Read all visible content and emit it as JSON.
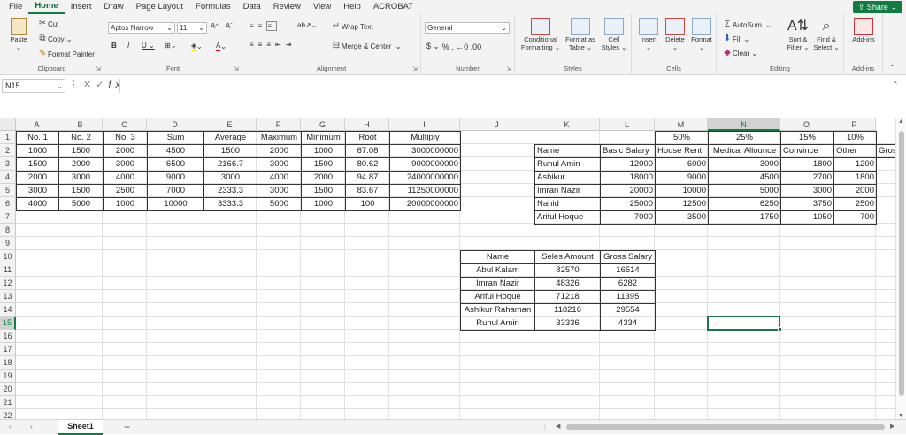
{
  "menu": [
    "File",
    "Home",
    "Insert",
    "Draw",
    "Page Layout",
    "Formulas",
    "Data",
    "Review",
    "View",
    "Help",
    "ACROBAT"
  ],
  "share_label": "Share",
  "ribbon": {
    "clipboard": {
      "paste": "Paste",
      "cut": "Cut",
      "copy": "Copy",
      "format_painter": "Format Painter",
      "label": "Clipboard"
    },
    "font": {
      "name": "Aptos Narrow",
      "size": "11",
      "label": "Font"
    },
    "alignment": {
      "wrap": "Wrap Text",
      "merge": "Merge & Center",
      "label": "Alignment"
    },
    "number": {
      "format": "General",
      "label": "Number"
    },
    "styles": {
      "conditional": [
        "Conditional",
        "Formatting"
      ],
      "format_table": [
        "Format as",
        "Table"
      ],
      "cell_styles": [
        "Cell",
        "Styles"
      ],
      "label": "Styles"
    },
    "cells": {
      "insert": "Insert",
      "delete": "Delete",
      "format": "Format",
      "label": "Cells"
    },
    "editing": {
      "autosum": "AutoSum",
      "fill": "Fill",
      "clear": "Clear",
      "sort": [
        "Sort &",
        "Filter"
      ],
      "find": [
        "Find &",
        "Select"
      ],
      "label": "Editing"
    },
    "addins": {
      "addins": "Add-ins",
      "label": "Add-ins"
    }
  },
  "namebox": "N15",
  "columns": [
    "A",
    "B",
    "C",
    "D",
    "E",
    "F",
    "G",
    "H",
    "I",
    "J",
    "K",
    "L",
    "M",
    "N",
    "O",
    "P"
  ],
  "rows": [
    "1",
    "2",
    "3",
    "4",
    "5",
    "6",
    "7",
    "8",
    "9",
    "10",
    "11",
    "12",
    "13",
    "14",
    "15",
    "16",
    "17",
    "18",
    "19",
    "20",
    "21",
    "22"
  ],
  "table1": {
    "headers": [
      "No. 1",
      "No. 2",
      "No. 3",
      "Sum",
      "Average",
      "Maximum",
      "Minimum",
      "Root",
      "Multiply"
    ],
    "rows": [
      [
        "1000",
        "1500",
        "2000",
        "4500",
        "1500",
        "2000",
        "1000",
        "67.08",
        "3000000000"
      ],
      [
        "1500",
        "2000",
        "3000",
        "6500",
        "2166.7",
        "3000",
        "1500",
        "80.62",
        "9000000000"
      ],
      [
        "2000",
        "3000",
        "4000",
        "9000",
        "3000",
        "4000",
        "2000",
        "94.87",
        "24000000000"
      ],
      [
        "3000",
        "1500",
        "2500",
        "7000",
        "2333.3",
        "3000",
        "1500",
        "83.67",
        "11250000000"
      ],
      [
        "4000",
        "5000",
        "1000",
        "10000",
        "3333.3",
        "5000",
        "1000",
        "100",
        "20000000000"
      ]
    ]
  },
  "table2": {
    "percents": [
      "",
      "",
      "50%",
      "25%",
      "15%",
      "10%"
    ],
    "headers": [
      "Name",
      "Basic Salary",
      "House Rent",
      "Medical Allounce",
      "Convince",
      "Other",
      "Gross"
    ],
    "rows": [
      [
        "Ruhul Amin",
        "12000",
        "6000",
        "3000",
        "1800",
        "1200"
      ],
      [
        "Ashikur",
        "18000",
        "9000",
        "4500",
        "2700",
        "1800"
      ],
      [
        "Imran Nazir",
        "20000",
        "10000",
        "5000",
        "3000",
        "2000"
      ],
      [
        "Nahid",
        "25000",
        "12500",
        "6250",
        "3750",
        "2500"
      ],
      [
        "Ariful Hoque",
        "7000",
        "3500",
        "1750",
        "1050",
        "700"
      ]
    ]
  },
  "table3": {
    "headers": [
      "Name",
      "Seles Amount",
      "Gross Salary"
    ],
    "rows": [
      [
        "Abul Kalam",
        "82570",
        "16514"
      ],
      [
        "Imran Nazir",
        "48326",
        "6282"
      ],
      [
        "Ariful Hoque",
        "71218",
        "11395"
      ],
      [
        "Ashikur Rahaman",
        "118216",
        "29554"
      ],
      [
        "Ruhul Amin",
        "33336",
        "4334"
      ]
    ]
  },
  "sheet_tab": "Sheet1"
}
